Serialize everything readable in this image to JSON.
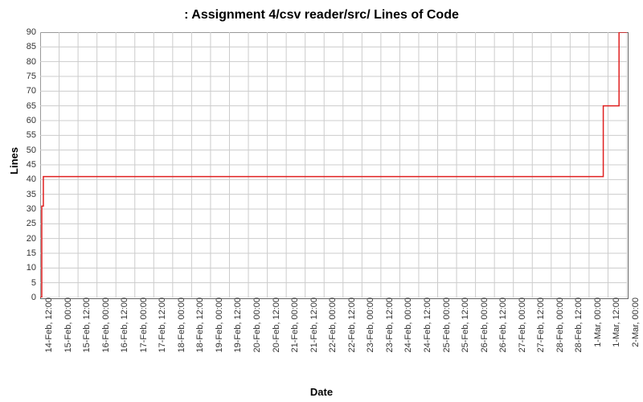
{
  "chart_data": {
    "type": "line",
    "title": ": Assignment 4/csv reader/src/ Lines of Code",
    "xlabel": "Date",
    "ylabel": "Lines",
    "ylim": [
      0,
      90
    ],
    "y_ticks": [
      0,
      5,
      10,
      15,
      20,
      25,
      30,
      35,
      40,
      45,
      50,
      55,
      60,
      65,
      70,
      75,
      80,
      85,
      90
    ],
    "x_ticks": [
      "14-Feb, 12:00",
      "15-Feb, 00:00",
      "15-Feb, 12:00",
      "16-Feb, 00:00",
      "16-Feb, 12:00",
      "17-Feb, 00:00",
      "17-Feb, 12:00",
      "18-Feb, 00:00",
      "18-Feb, 12:00",
      "19-Feb, 00:00",
      "19-Feb, 12:00",
      "20-Feb, 00:00",
      "20-Feb, 12:00",
      "21-Feb, 00:00",
      "21-Feb, 12:00",
      "22-Feb, 00:00",
      "22-Feb, 12:00",
      "23-Feb, 00:00",
      "23-Feb, 12:00",
      "24-Feb, 00:00",
      "24-Feb, 12:00",
      "25-Feb, 00:00",
      "25-Feb, 12:00",
      "26-Feb, 00:00",
      "26-Feb, 12:00",
      "27-Feb, 00:00",
      "27-Feb, 12:00",
      "28-Feb, 00:00",
      "28-Feb, 12:00",
      "1-Mar, 00:00",
      "1-Mar, 12:00",
      "2-Mar, 00:00"
    ],
    "series": [
      {
        "name": "Lines of Code",
        "step": true,
        "points": [
          {
            "x": "14-Feb, 12:00",
            "y": 0
          },
          {
            "x": "14-Feb, 13:00",
            "y": 31
          },
          {
            "x": "14-Feb, 14:00",
            "y": 41
          },
          {
            "x": "1-Mar, 09:00",
            "y": 41
          },
          {
            "x": "1-Mar, 09:00",
            "y": 65
          },
          {
            "x": "1-Mar, 19:00",
            "y": 65
          },
          {
            "x": "1-Mar, 19:00",
            "y": 90
          },
          {
            "x": "2-Mar, 00:00",
            "y": 90
          }
        ]
      }
    ]
  }
}
